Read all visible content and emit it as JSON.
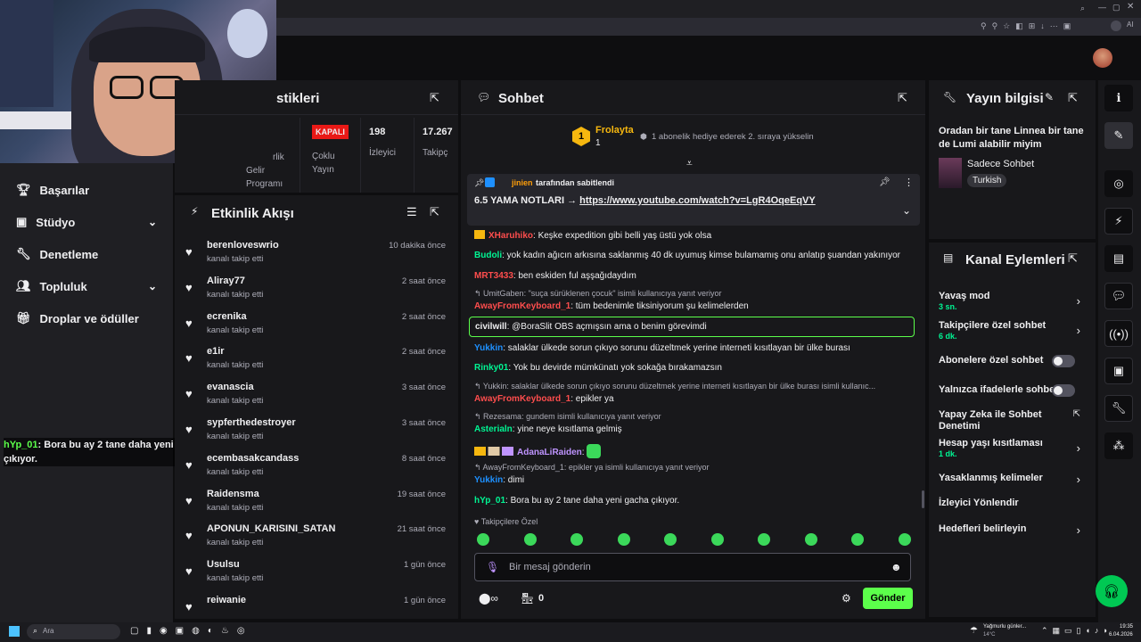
{
  "stats": {
    "title": "stikleri",
    "left_label1": "rlik",
    "left_label2": "Gelir",
    "left_label3": "Programı",
    "kapali": "KAPALI",
    "coklu1": "Çoklu",
    "coklu2": "Yayın",
    "viewers": "198",
    "viewers_label": "İzleyici",
    "followers": "17.267",
    "followers_label": "Takipç"
  },
  "nav": {
    "items": [
      {
        "label": "Başarılar",
        "icon": "trophy-icon"
      },
      {
        "label": "Stüdyo",
        "icon": "studio-icon",
        "expand": true
      },
      {
        "label": "Denetleme",
        "icon": "wrench-icon"
      },
      {
        "label": "Topluluk",
        "icon": "community-icon",
        "expand": true
      },
      {
        "label": "Droplar ve ödüller",
        "icon": "gift-icon"
      }
    ]
  },
  "overlay": {
    "user": "hYp_01",
    "text1": ": Bora bu ay 2 tane daha yeni gacha",
    "text2": "çıkıyor."
  },
  "activity": {
    "title": "Etkinlik Akışı",
    "events": [
      {
        "name": "berenloveswrio",
        "sub": "kanalı takip etti",
        "time": "10 dakika önce"
      },
      {
        "name": "Aliray77",
        "sub": "kanalı takip etti",
        "time": "2 saat önce"
      },
      {
        "name": "ecrenika",
        "sub": "kanalı takip etti",
        "time": "2 saat önce"
      },
      {
        "name": "e1ir",
        "sub": "kanalı takip etti",
        "time": "2 saat önce"
      },
      {
        "name": "evanascia",
        "sub": "kanalı takip etti",
        "time": "3 saat önce"
      },
      {
        "name": "sypferthedestroyer",
        "sub": "kanalı takip etti",
        "time": "3 saat önce"
      },
      {
        "name": "ecembasakcandass",
        "sub": "kanalı takip etti",
        "time": "8 saat önce"
      },
      {
        "name": "Raidensma",
        "sub": "kanalı takip etti",
        "time": "19 saat önce"
      },
      {
        "name": "APONUN_KARISINI_SATAN",
        "sub": "kanalı takip etti",
        "time": "21 saat önce"
      },
      {
        "name": "Usulsu",
        "sub": "kanalı takip etti",
        "time": "1 gün önce"
      },
      {
        "name": "reiwanie",
        "sub": "",
        "time": "1 gün önce"
      }
    ]
  },
  "chat": {
    "title": "Sohbet",
    "hype": {
      "name": "Frolayta",
      "rank": "1",
      "count": "1",
      "text": "1 abonelik hediye ederek 2. sıraya yükselin"
    },
    "pinned": {
      "by": "jinien",
      "by_text": "tarafından sabitlendi",
      "text": "6.5 YAMA NOTLARI → ",
      "link": "https://www.youtube.com/watch?v=LgR4OqeEqVY"
    },
    "messages": [
      {
        "user": "XHaruhiko",
        "color": "#ff4d4d",
        "text": ": Keşke expedition gibi belli yaş üstü yok olsa"
      },
      {
        "user": "Budoli",
        "color": "#00f593",
        "text": ": yok kadın ağıcın arkısına saklanmış 40 dk uyumuş kimse bulamamış onu anlatıp şuandan yakınıyor"
      },
      {
        "user": "MRT3433",
        "color": "#ff4d4d",
        "text": ": ben eskiden ful aşşağıdaydım"
      },
      {
        "reply": "UmitGaben: \"suça sürüklenen çocuk\" isimli kullanıcıya yanıt veriyor"
      },
      {
        "user": "AwayFromKeyboard_1",
        "color": "#ff4d4d",
        "text": ": tüm bedenimle tiksiniyorum şu kelimelerden"
      },
      {
        "user": "civilwill",
        "color": "#efeff1",
        "text": ": @BoraSlit OBS açmışsın ama o benim görevimdi",
        "highlight": true
      },
      {
        "user": "Yukkin",
        "color": "#1e90ff",
        "text": ": salaklar ülkede sorun çıkıyo sorunu düzeltmek yerine interneti kısıtlayan bir ülke burası"
      },
      {
        "user": "Rinky01",
        "color": "#00f593",
        "text": ": Yok bu devirde mümkünatı yok sokağa bırakamazsın"
      },
      {
        "reply": "Yukkin: salaklar ülkede sorun çıkıyo sorunu düzeltmek yerine interneti kısıtlayan bir ülke burası isimli kullanıc..."
      },
      {
        "user": "AwayFromKeyboard_1",
        "color": "#ff4d4d",
        "text": ": epikler ya"
      },
      {
        "reply": "Rezesama: gundem isimli kullanıcıya yanıt veriyor"
      },
      {
        "user": "Asterialn",
        "color": "#00f593",
        "text": ": yine neye kısıtlama gelmiş"
      },
      {
        "user": "AdanaLiRaiden",
        "color": "#bf94ff",
        "text": ":"
      },
      {
        "reply": "AwayFromKeyboard_1: epikler ya isimli kullanıcıya yanıt veriyor"
      },
      {
        "user": "Yukkin",
        "color": "#1e90ff",
        "text": ": dimi"
      },
      {
        "user": "hYp_01",
        "color": "#00f593",
        "text": ": Bora bu ay 2 tane daha yeni gacha çıkıyor."
      }
    ],
    "followers_only": "Takipçilere Özel",
    "input_placeholder": "Bir mesaj gönderin",
    "points": "0",
    "send": "Gönder"
  },
  "stream_info": {
    "title": "Yayın bilgisi",
    "stream_title": "Oradan bir tane Linnea bir tane de Lumi alabilir miyim",
    "category": "Sadece Sohbet",
    "tag": "Turkish"
  },
  "channel_actions": {
    "title": "Kanal Eylemleri",
    "items": [
      {
        "label": "Yavaş mod",
        "value": "3 sn.",
        "control": "chevron"
      },
      {
        "label": "Takipçilere özel sohbet",
        "value": "6 dk.",
        "control": "chevron"
      },
      {
        "label": "Abonelere özel sohbet",
        "value": "",
        "control": "toggle"
      },
      {
        "label": "Yalnızca ifadelerle sohbet",
        "value": "",
        "control": "toggle"
      },
      {
        "label": "Yapay Zeka ile Sohbet Denetimi",
        "value": "",
        "control": "external"
      },
      {
        "label": "Hesap yaşı kısıtlaması",
        "value": "1 dk.",
        "control": "chevron"
      },
      {
        "label": "Yasaklanmış kelimeler",
        "value": "",
        "control": "chevron"
      },
      {
        "label": "İzleyici Yönlendir",
        "value": "",
        "control": "none"
      },
      {
        "label": "Hedefleri belirleyin",
        "value": "",
        "control": "chevron"
      }
    ]
  },
  "taskbar": {
    "search": "Ara",
    "weather": "Yağmurlu günler...",
    "temp": "14°C",
    "time": "19:35",
    "date": "6.04.2026"
  },
  "colors": {
    "accent": "#9147ff",
    "green": "#00f593",
    "send": "#5cff4b"
  }
}
